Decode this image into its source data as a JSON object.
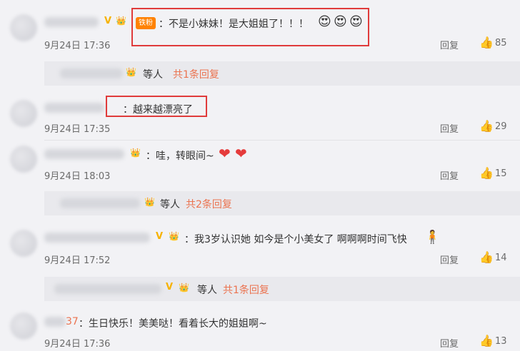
{
  "comments": [
    {
      "badge": "铁粉",
      "text": "：不是小妹妹！是大姐姐了！！！",
      "time": "9月24日 17:36",
      "reply": "回复",
      "likes": "85"
    },
    {
      "text": "：越来越漂亮了",
      "time": "9月24日 17:35",
      "reply": "回复",
      "likes": "29"
    },
    {
      "text": "：哇，转眼间~",
      "time": "9月24日 18:03",
      "reply": "回复",
      "likes": "15"
    },
    {
      "text": "：我3岁认识她 如今是个小美女了 啊啊啊时间飞快",
      "time": "9月24日 17:52",
      "reply": "回复",
      "likes": "14"
    },
    {
      "name_visible": "37",
      "text": "：生日快乐！美美哒！看着长大的姐姐啊~",
      "time": "9月24日 17:36",
      "reply": "回复",
      "likes": "13"
    }
  ],
  "subreplies": [
    {
      "label": "等人",
      "count": "共1条回复"
    },
    {
      "label": "等人",
      "count": "共2条回复"
    },
    {
      "label": "等人",
      "count": "共1条回复"
    }
  ],
  "glyphs": {
    "vip": "V",
    "crown": "👑",
    "heart": "❤",
    "like": "👍",
    "emoji": "😍",
    "person": "🧍"
  }
}
